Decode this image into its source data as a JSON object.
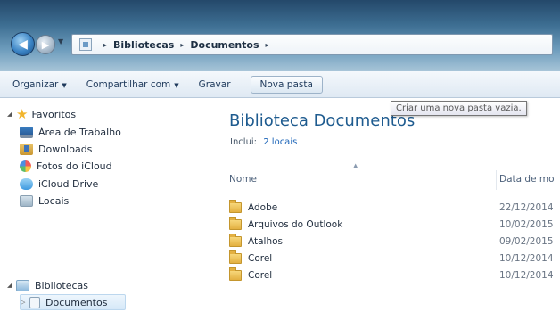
{
  "address_bar": {
    "breadcrumbs": [
      "Bibliotecas",
      "Documentos"
    ],
    "separator": "▸"
  },
  "command_bar": {
    "organize": "Organizar",
    "share_with": "Compartilhar com",
    "burn": "Gravar",
    "new_folder": "Nova pasta",
    "dropdown_glyph": "▼"
  },
  "tooltip": "Criar uma nova pasta vazia.",
  "nav_pane": {
    "favorites": {
      "label": "Favoritos",
      "items": [
        "Área de Trabalho",
        "Downloads",
        "Fotos do iCloud",
        "iCloud Drive",
        "Locais"
      ]
    },
    "libraries": {
      "label": "Bibliotecas",
      "items": [
        "Documentos"
      ]
    }
  },
  "content": {
    "title": "Biblioteca Documentos",
    "includes_label": "Inclui:",
    "includes_link": "2 locais",
    "columns": {
      "name": "Nome",
      "date": "Data de mo"
    },
    "rows": [
      {
        "name": "Adobe",
        "date": "22/12/2014"
      },
      {
        "name": "Arquivos do Outlook",
        "date": "10/02/2015"
      },
      {
        "name": "Atalhos",
        "date": "09/02/2015"
      },
      {
        "name": "Corel",
        "date": "10/12/2014"
      },
      {
        "name": "Corel",
        "date": "10/12/2014"
      }
    ]
  }
}
